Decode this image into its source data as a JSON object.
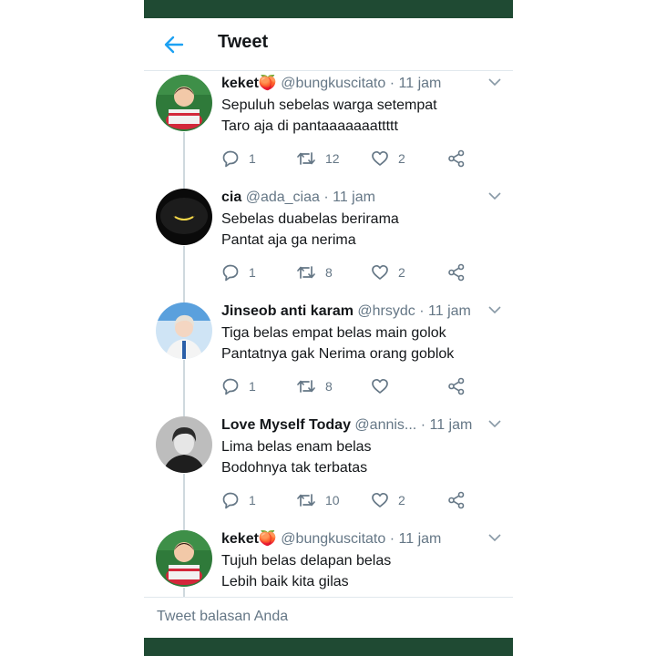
{
  "header": {
    "title": "Tweet",
    "back_icon": "arrow-left-icon"
  },
  "colors": {
    "accent": "#1da1f2",
    "status_bar": "#1f4a33",
    "text": "#14171a",
    "muted": "#657786"
  },
  "tweets": [
    {
      "name": "keket",
      "emoji": "🍑",
      "handle": "@bungkuscitato",
      "time": "· 11 jam",
      "lines": [
        "Sepuluh sebelas warga setempat",
        "Taro aja di pantaaaaaaattttt"
      ],
      "reply_count": "1",
      "retweet_count": "12",
      "like_count": "2"
    },
    {
      "name": "cia",
      "emoji": "",
      "handle": "@ada_ciaa",
      "time": "· 11 jam",
      "lines": [
        "Sebelas duabelas berirama",
        "Pantat aja ga nerima"
      ],
      "reply_count": "1",
      "retweet_count": "8",
      "like_count": "2"
    },
    {
      "name": "Jinseob anti karam",
      "emoji": "",
      "handle": "@hrsydc",
      "time": "· 11 jam",
      "lines": [
        "Tiga belas empat belas main golok",
        "Pantatnya gak Nerima orang goblok"
      ],
      "reply_count": "1",
      "retweet_count": "8",
      "like_count": ""
    },
    {
      "name": "Love Myself Today",
      "emoji": "",
      "handle": "@annis...",
      "time": "· 11 jam",
      "lines": [
        "Lima belas enam belas",
        "Bodohnya tak terbatas"
      ],
      "reply_count": "1",
      "retweet_count": "10",
      "like_count": "2"
    },
    {
      "name": "keket",
      "emoji": "🍑",
      "handle": "@bungkuscitato",
      "time": "· 11 jam",
      "lines": [
        "Tujuh belas delapan belas",
        "Lebih baik kita gilas"
      ],
      "reply_count": "",
      "retweet_count": "",
      "like_count": ""
    }
  ],
  "reply_box": {
    "placeholder": "Tweet balasan Anda"
  }
}
